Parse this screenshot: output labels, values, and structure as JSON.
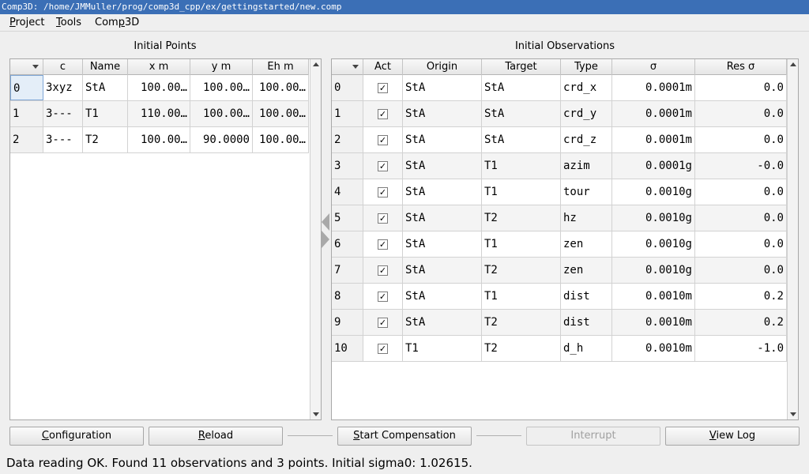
{
  "window": {
    "title": "Comp3D: /home/JMMuller/prog/comp3d_cpp/ex/gettingstarted/new.comp"
  },
  "menu": [
    {
      "before": "",
      "accel": "P",
      "after": "roject"
    },
    {
      "before": "",
      "accel": "T",
      "after": "ools"
    },
    {
      "before": "Com",
      "accel": "p",
      "after": "3D"
    }
  ],
  "points": {
    "title": "Initial Points",
    "columns": [
      "",
      "c",
      "Name",
      "x m",
      "y m",
      "Eh m"
    ],
    "rows": [
      [
        "0",
        "3xyz",
        "StA",
        "100.00…",
        "100.00…",
        "100.00…"
      ],
      [
        "1",
        "3---",
        "T1",
        "110.00…",
        "100.00…",
        "100.00…"
      ],
      [
        "2",
        "3---",
        "T2",
        "100.00…",
        "90.0000",
        "100.00…"
      ]
    ]
  },
  "observations": {
    "title": "Initial Observations",
    "columns": [
      "",
      "Act",
      "Origin",
      "Target",
      "Type",
      "σ",
      "Res σ"
    ],
    "rows": [
      [
        "0",
        true,
        "StA",
        "StA",
        "crd_x",
        "0.0001m",
        "0.0"
      ],
      [
        "1",
        true,
        "StA",
        "StA",
        "crd_y",
        "0.0001m",
        "0.0"
      ],
      [
        "2",
        true,
        "StA",
        "StA",
        "crd_z",
        "0.0001m",
        "0.0"
      ],
      [
        "3",
        true,
        "StA",
        "T1",
        "azim",
        "0.0001g",
        "-0.0"
      ],
      [
        "4",
        true,
        "StA",
        "T1",
        "tour",
        "0.0010g",
        "0.0"
      ],
      [
        "5",
        true,
        "StA",
        "T2",
        "hz",
        "0.0010g",
        "0.0"
      ],
      [
        "6",
        true,
        "StA",
        "T1",
        "zen",
        "0.0010g",
        "0.0"
      ],
      [
        "7",
        true,
        "StA",
        "T2",
        "zen",
        "0.0010g",
        "0.0"
      ],
      [
        "8",
        true,
        "StA",
        "T1",
        "dist",
        "0.0010m",
        "0.2"
      ],
      [
        "9",
        true,
        "StA",
        "T2",
        "dist",
        "0.0010m",
        "0.2"
      ],
      [
        "10",
        true,
        "T1",
        "T2",
        "d_h",
        "0.0010m",
        "-1.0"
      ]
    ]
  },
  "buttons": {
    "configuration": {
      "accel": "C",
      "rest": "onfiguration"
    },
    "reload": {
      "accel": "R",
      "rest": "eload"
    },
    "start": {
      "accel": "S",
      "rest": "tart Compensation"
    },
    "interrupt": {
      "accel": "",
      "rest": "Interrupt"
    },
    "viewlog": {
      "accel": "V",
      "rest": "iew Log"
    }
  },
  "status": {
    "message": "Data reading OK. Found 11 observations and 3 points. Initial sigma0: 1.02615."
  },
  "icons": {
    "splitter_left": "triangle-left-icon",
    "splitter_right": "triangle-right-icon",
    "checkmark": "checkmark-icon"
  },
  "colors": {
    "titlebar": "#3b6fb6",
    "selection": "#e4eef8"
  }
}
